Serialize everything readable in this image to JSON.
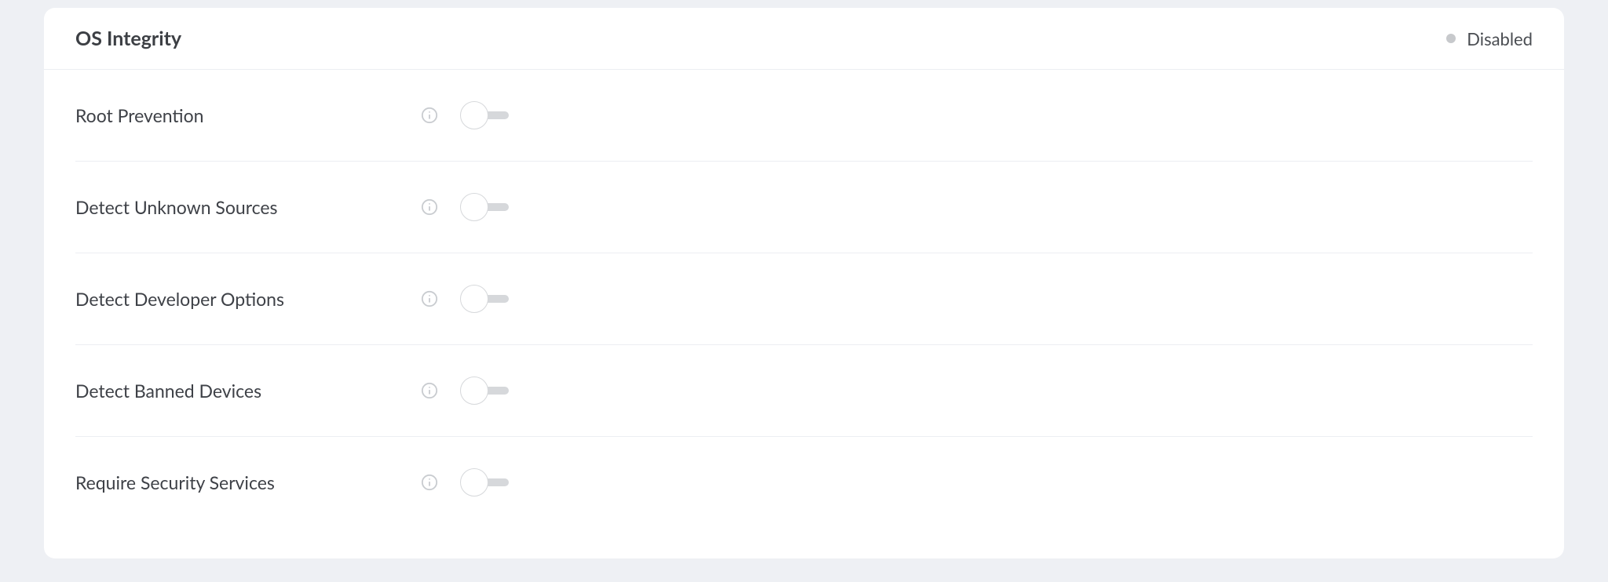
{
  "panel": {
    "title": "OS Integrity",
    "status_label": "Disabled",
    "status_color": "#c7c9cc"
  },
  "settings": [
    {
      "label": "Root Prevention",
      "enabled": false
    },
    {
      "label": "Detect Unknown Sources",
      "enabled": false
    },
    {
      "label": "Detect Developer Options",
      "enabled": false
    },
    {
      "label": "Detect Banned Devices",
      "enabled": false
    },
    {
      "label": "Require Security Services",
      "enabled": false
    }
  ]
}
